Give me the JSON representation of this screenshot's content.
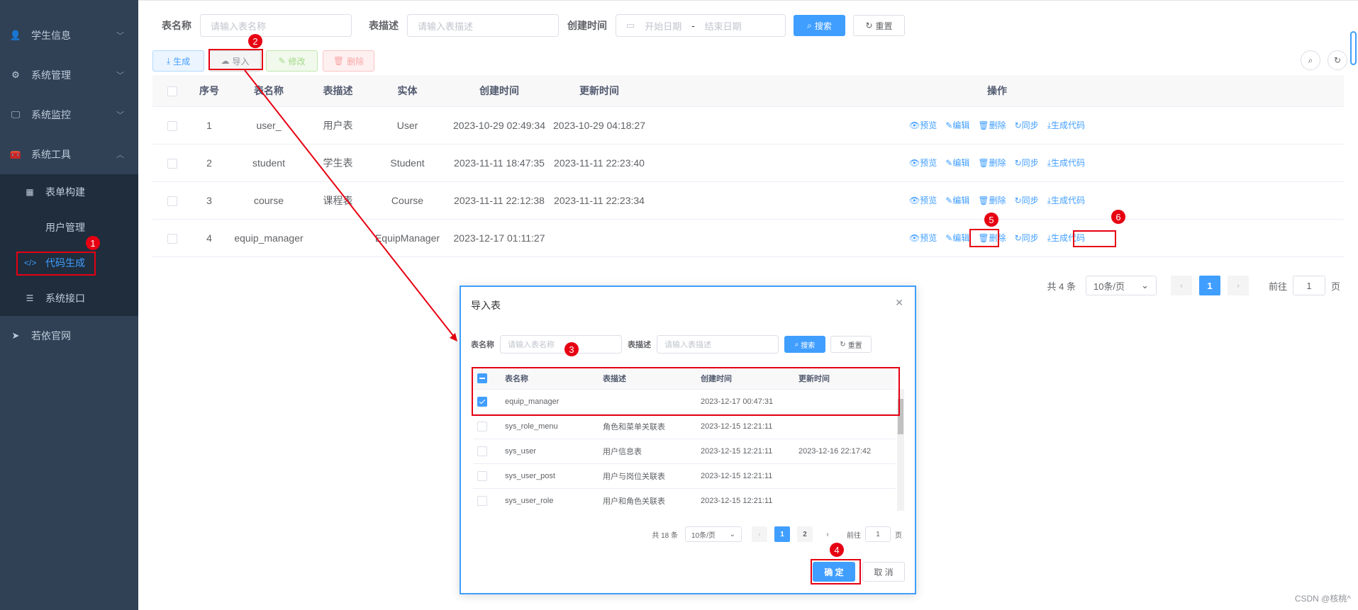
{
  "sidebar": {
    "items": [
      {
        "label": "学生信息",
        "icon": "user-icon",
        "chev": "﹀"
      },
      {
        "label": "系统管理",
        "icon": "gear-icon",
        "chev": "﹀"
      },
      {
        "label": "系统监控",
        "icon": "monitor-icon",
        "chev": "﹀"
      },
      {
        "label": "系统工具",
        "icon": "toolbox-icon",
        "chev": "︿"
      }
    ],
    "sub_items": [
      {
        "label": "表单构建",
        "icon": "grid-icon"
      },
      {
        "label": "用户管理"
      },
      {
        "label": "代码生成",
        "icon": "code-icon"
      },
      {
        "label": "系统接口",
        "icon": "sliders-icon"
      }
    ],
    "bottom_item": {
      "label": "若依官网",
      "icon": "send-icon"
    }
  },
  "search": {
    "table_name_label": "表名称",
    "table_name_placeholder": "请输入表名称",
    "table_desc_label": "表描述",
    "table_desc_placeholder": "请输入表描述",
    "create_time_label": "创建时间",
    "start_date": "开始日期",
    "date_sep": "-",
    "end_date": "结束日期",
    "search_btn": "搜索",
    "reset_btn": "重置"
  },
  "toolbar": {
    "generate": "生成",
    "import": "导入",
    "edit": "修改",
    "delete": "删除"
  },
  "table": {
    "headers": [
      "序号",
      "表名称",
      "表描述",
      "实体",
      "创建时间",
      "更新时间",
      "操作"
    ],
    "rows": [
      {
        "no": "1",
        "name": "user_",
        "desc": "用户表",
        "entity": "User",
        "created": "2023-10-29 02:49:34",
        "updated": "2023-10-29 04:18:27"
      },
      {
        "no": "2",
        "name": "student",
        "desc": "学生表",
        "entity": "Student",
        "created": "2023-11-11 18:47:35",
        "updated": "2023-11-11 22:23:40"
      },
      {
        "no": "3",
        "name": "course",
        "desc": "课程表",
        "entity": "Course",
        "created": "2023-11-11 22:12:38",
        "updated": "2023-11-11 22:23:34"
      },
      {
        "no": "4",
        "name": "equip_manager",
        "desc": "",
        "entity": "EquipManager",
        "created": "2023-12-17 01:11:27",
        "updated": ""
      }
    ],
    "ops": {
      "preview": "预览",
      "edit": "编辑",
      "delete": "删除",
      "sync": "同步",
      "gen": "生成代码"
    }
  },
  "pager": {
    "total": "共 4 条",
    "page_size": "10条/页",
    "current": "1",
    "goto": "前往",
    "goto_value": "1",
    "page_unit": "页"
  },
  "dialog": {
    "title": "导入表",
    "table_name_label": "表名称",
    "table_name_placeholder": "请输入表名称",
    "table_desc_label": "表描述",
    "table_desc_placeholder": "请输入表描述",
    "search_btn": "搜索",
    "reset_btn": "重置",
    "headers": [
      "表名称",
      "表描述",
      "创建时间",
      "更新时间"
    ],
    "rows": [
      {
        "name": "equip_manager",
        "desc": "",
        "created": "2023-12-17 00:47:31",
        "updated": "",
        "checked": true
      },
      {
        "name": "sys_role_menu",
        "desc": "角色和菜单关联表",
        "created": "2023-12-15 12:21:11",
        "updated": "",
        "checked": false
      },
      {
        "name": "sys_user",
        "desc": "用户信息表",
        "created": "2023-12-15 12:21:11",
        "updated": "2023-12-16 22:17:42",
        "checked": false
      },
      {
        "name": "sys_user_post",
        "desc": "用户与岗位关联表",
        "created": "2023-12-15 12:21:11",
        "updated": "",
        "checked": false
      },
      {
        "name": "sys_user_role",
        "desc": "用户和角色关联表",
        "created": "2023-12-15 12:21:11",
        "updated": "",
        "checked": false
      }
    ],
    "pager": {
      "total": "共 18 条",
      "page_size": "10条/页",
      "page1": "1",
      "page2": "2",
      "goto": "前往",
      "goto_value": "1",
      "page_unit": "页"
    },
    "confirm": "确 定",
    "cancel": "取 消"
  },
  "annotations": [
    "1",
    "2",
    "3",
    "4",
    "5",
    "6"
  ],
  "watermark": "CSDN @核桃^",
  "colors": {
    "accent": "#409eff",
    "sidebar_bg": "#304156",
    "annotation_red": "#e60012"
  }
}
